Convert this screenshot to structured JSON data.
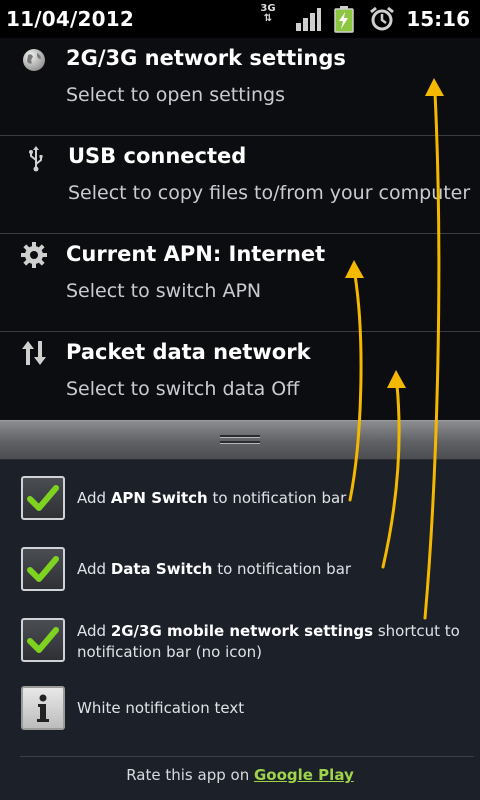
{
  "status_bar": {
    "date": "11/04/2012",
    "time": "15:16",
    "network_label": "3G",
    "icons": [
      "3g-data-icon",
      "signal-icon",
      "battery-charging-icon",
      "alarm-icon"
    ]
  },
  "notifications": [
    {
      "icon": "globe-icon",
      "title": "2G/3G network settings",
      "subtitle": "Select to open settings"
    },
    {
      "icon": "usb-icon",
      "title": "USB connected",
      "subtitle": "Select to copy files to/from your computer"
    },
    {
      "icon": "gear-icon",
      "title": "Current APN: Internet",
      "subtitle": "Select to switch APN"
    },
    {
      "icon": "data-arrows-icon",
      "title": "Packet data network",
      "subtitle": "Select to switch data Off"
    }
  ],
  "settings": [
    {
      "prefix": "Add ",
      "bold": "APN Switch",
      "suffix": " to notification bar",
      "checked": true
    },
    {
      "prefix": "Add ",
      "bold": "Data Switch",
      "suffix": " to notification bar",
      "checked": true
    },
    {
      "prefix": "Add ",
      "bold": "2G/3G mobile network settings",
      "suffix": " shortcut to notification bar (no icon)",
      "checked": true
    },
    {
      "label": "White notification text",
      "icon": "info-icon"
    }
  ],
  "footer": {
    "text": "Rate this app on ",
    "link": "Google Play"
  },
  "colors": {
    "background": "#1b2029",
    "drawer": "#0c0d10",
    "check": "#7ed321",
    "link": "#9fd44a",
    "annotation_arrow": "#f5b800"
  }
}
